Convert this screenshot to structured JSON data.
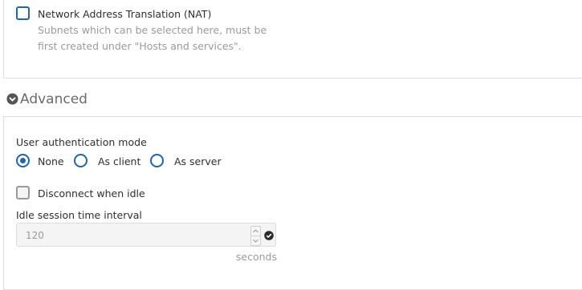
{
  "nat": {
    "checkbox_label": "Network Address Translation (NAT)",
    "hint": "Subnets which can be selected here, must be first created under \"Hosts and services\"."
  },
  "advanced": {
    "section_title": "Advanced",
    "auth_mode_label": "User authentication mode",
    "auth_options": [
      {
        "label": "None",
        "selected": true
      },
      {
        "label": "As client",
        "selected": false
      },
      {
        "label": "As server",
        "selected": false
      }
    ],
    "disconnect_label": "Disconnect when idle",
    "idle_interval_label": "Idle session time interval",
    "idle_interval_value": "120",
    "idle_interval_unit": "seconds"
  },
  "colors": {
    "accent": "#1a66b3",
    "muted_text": "#9a9a9a",
    "border": "#dcdcdc",
    "disabled_bg": "#f4f4f4"
  },
  "icons": {
    "section_toggle": "chevron-down-circle-icon",
    "input_status": "check-circle-icon",
    "spin_up": "caret-up-icon",
    "spin_down": "caret-down-icon"
  }
}
